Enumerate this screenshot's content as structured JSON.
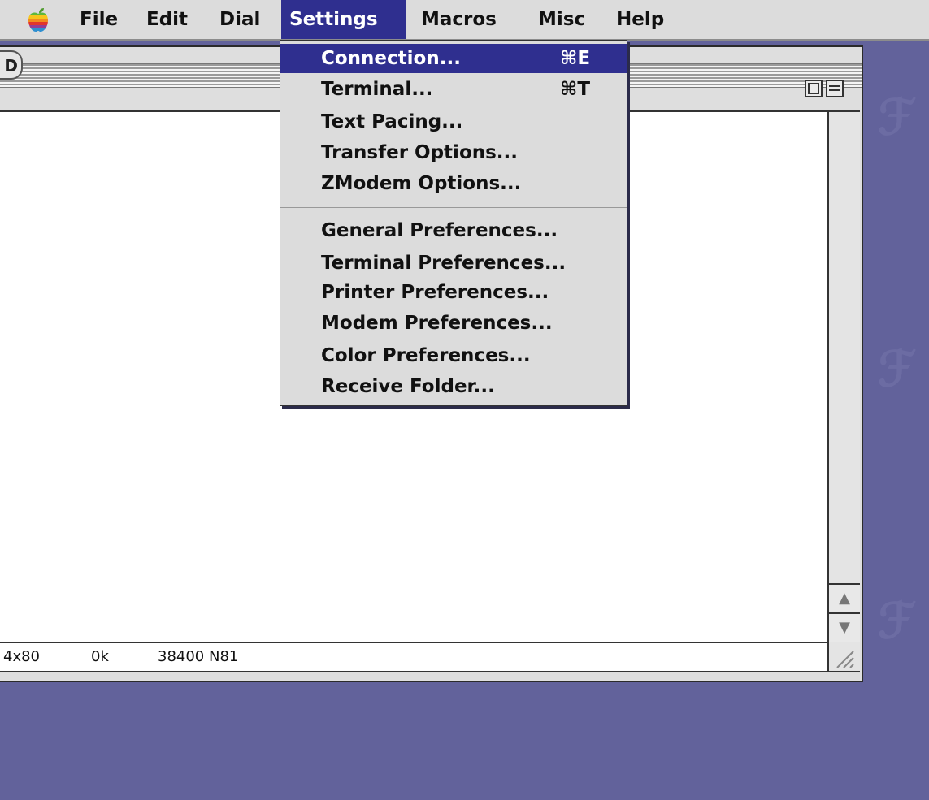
{
  "menubar": {
    "apple_icon": "apple-logo-icon",
    "items": [
      {
        "label": "File"
      },
      {
        "label": "Edit"
      },
      {
        "label": "Dial"
      },
      {
        "label": "Settings",
        "active": true
      },
      {
        "label": "Macros"
      },
      {
        "label": "Misc"
      },
      {
        "label": "Help"
      }
    ]
  },
  "settings_menu": {
    "items": [
      {
        "label": "Connection...",
        "shortcut": "⌘E",
        "highlighted": true
      },
      {
        "label": "Terminal...",
        "shortcut": "⌘T"
      },
      {
        "label": "Text Pacing...",
        "shortcut": ""
      },
      {
        "label": "Transfer Options...",
        "shortcut": ""
      },
      {
        "label": "ZModem Options...",
        "shortcut": ""
      },
      {
        "label": "General Preferences...",
        "shortcut": ""
      },
      {
        "label": "Terminal Preferences...",
        "shortcut": ""
      },
      {
        "label": "Printer Preferences...",
        "shortcut": ""
      },
      {
        "label": "Modem Preferences...",
        "shortcut": ""
      },
      {
        "label": "Color Preferences...",
        "shortcut": ""
      },
      {
        "label": "Receive Folder...",
        "shortcut": ""
      }
    ]
  },
  "status_bar": {
    "size": "4x80",
    "buffer": "0k",
    "connection": "38400 N81"
  },
  "colors": {
    "desktop": "#62629b",
    "highlight": "#2f2f8f",
    "menu_bg": "#dcdcdc"
  }
}
